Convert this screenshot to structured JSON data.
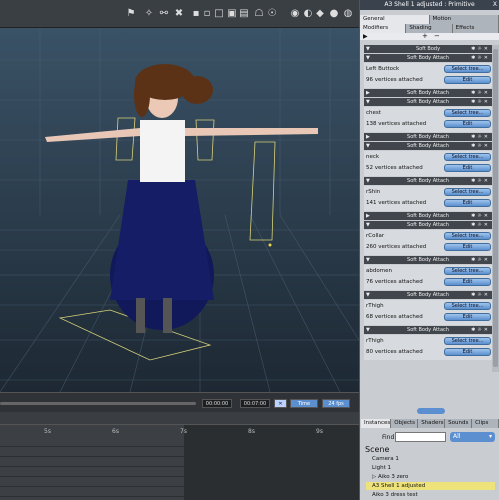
{
  "window": {
    "title": "A3 Shell 1 adjusted : Primitive",
    "close": "X"
  },
  "tabs_top": [
    "General",
    "Motion"
  ],
  "tabs_second": [
    "Modifiers",
    "Shading",
    "Effects"
  ],
  "modifiers": [
    {
      "header": "Soft Body",
      "label": "",
      "count": ""
    },
    {
      "header": "Soft Body Attach",
      "label": "Left Buttock",
      "count": "96 vertices attached"
    },
    {
      "header": "Soft Body Attach",
      "label": "",
      "count": ""
    },
    {
      "header": "Soft Body Attach",
      "label": "chest",
      "count": "138 vertices attached"
    },
    {
      "header": "Soft Body Attach",
      "label": "",
      "count": ""
    },
    {
      "header": "Soft Body Attach",
      "label": "neck",
      "count": "52 vertices attached"
    },
    {
      "header": "Soft Body Attach",
      "label": "rShin",
      "count": "141 vertices attached"
    },
    {
      "header": "Soft Body Attach",
      "label": "",
      "count": ""
    },
    {
      "header": "Soft Body Attach",
      "label": "rCollar",
      "count": "260 vertices attached"
    },
    {
      "header": "Soft Body Attach",
      "label": "abdomen",
      "count": "76 vertices attached"
    },
    {
      "header": "Soft Body Attach",
      "label": "rThigh",
      "count": "68 vertices attached"
    },
    {
      "header": "Soft Body Attach",
      "label": "rThigh",
      "count": "80 vertices attached"
    }
  ],
  "buttons": {
    "select_tree": "Select tree...",
    "edit": "Edit"
  },
  "timeline": {
    "time_current": "00:00:00",
    "time_end": "00:07:00",
    "mode": "Time",
    "fps": "24 fps",
    "ticks": [
      "5s",
      "6s",
      "7s",
      "8s",
      "9s"
    ]
  },
  "instances": {
    "tabs": [
      "Instances",
      "Objects",
      "Shaders",
      "Sounds",
      "Clips"
    ],
    "find_label": "Find",
    "filter": "All",
    "scene_title": "Scene",
    "items": [
      {
        "name": "Camera 1",
        "selected": false
      },
      {
        "name": "Light 1",
        "selected": false
      },
      {
        "name": "Aiko 3 zero",
        "selected": false
      },
      {
        "name": "A3 Shell 1 adjusted",
        "selected": true
      },
      {
        "name": "Aiko 3 dress test",
        "selected": false
      }
    ]
  },
  "colors": {
    "accent_button": "#5b8fcf",
    "selection": "#eee37a",
    "viewport_bg": "#232a33"
  }
}
